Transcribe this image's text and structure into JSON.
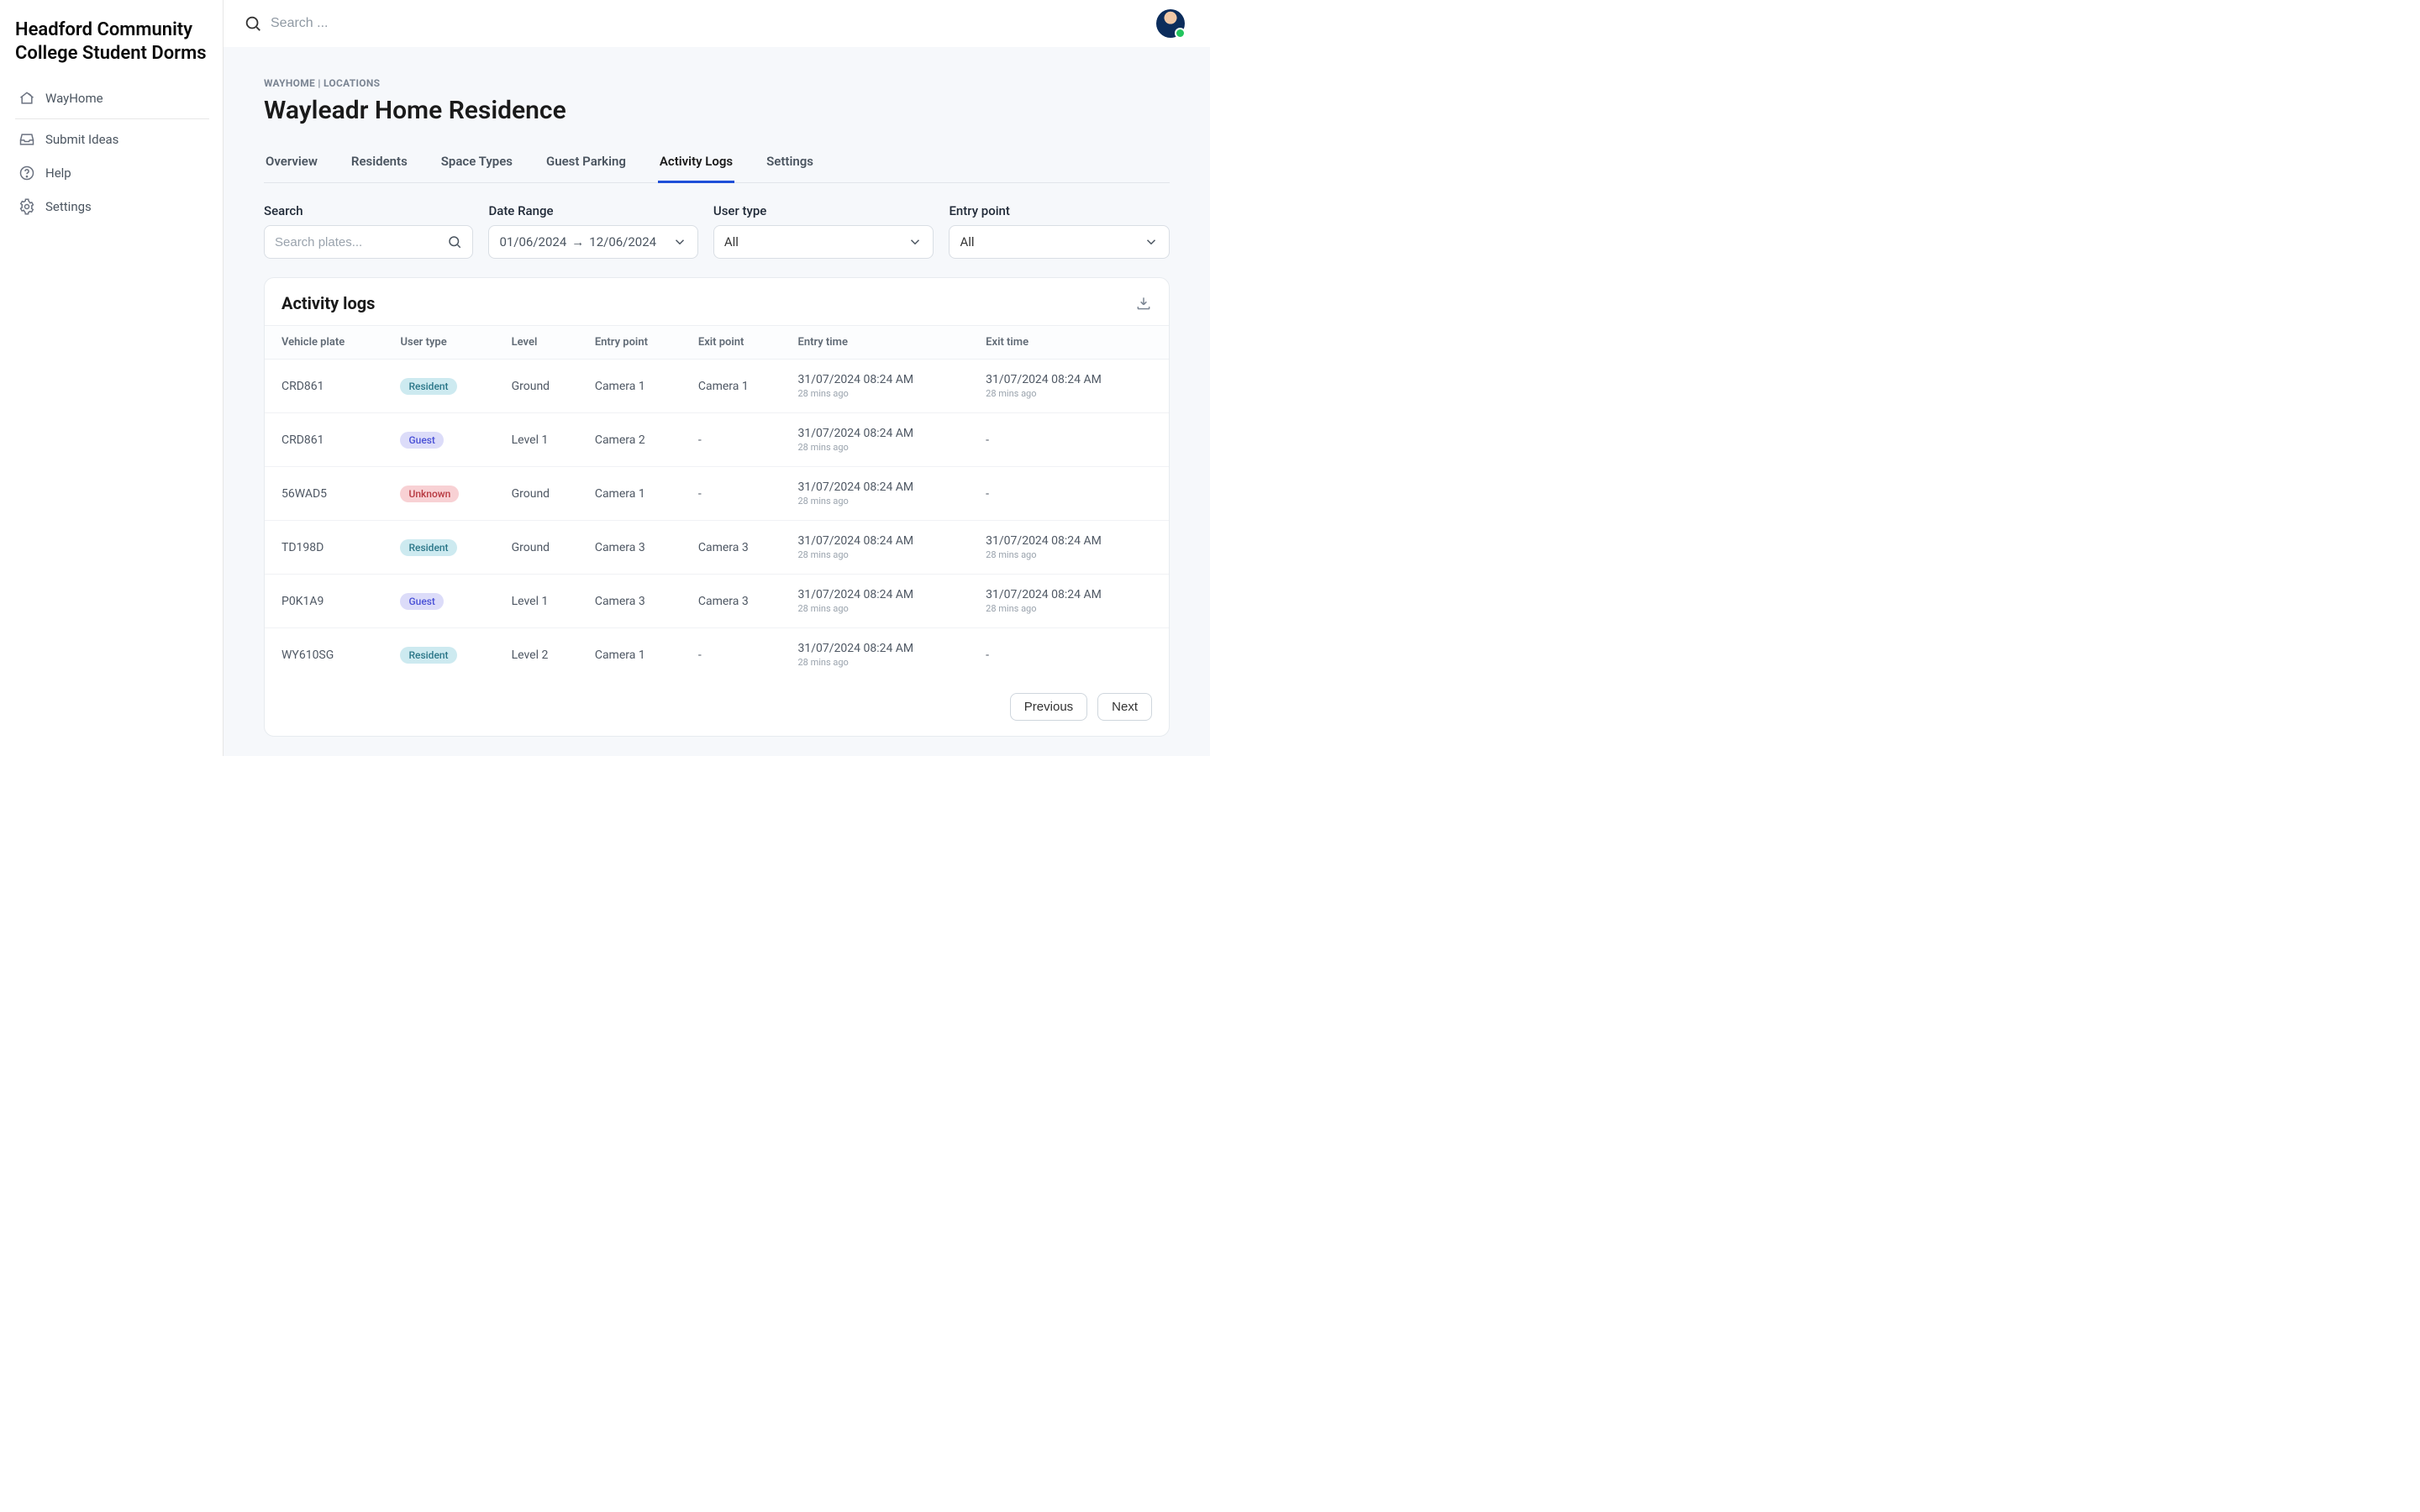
{
  "sidebar": {
    "title": "Headford Community College Student Dorms",
    "nav": [
      {
        "label": "WayHome",
        "icon": "home"
      },
      {
        "label": "Submit Ideas",
        "icon": "inbox"
      },
      {
        "label": "Help",
        "icon": "help"
      },
      {
        "label": "Settings",
        "icon": "gear"
      }
    ]
  },
  "topbar": {
    "search_placeholder": "Search ..."
  },
  "breadcrumb": "WAYHOME | LOCATIONS",
  "page_title": "Wayleadr Home Residence",
  "tabs": [
    {
      "label": "Overview",
      "active": false
    },
    {
      "label": "Residents",
      "active": false
    },
    {
      "label": "Space Types",
      "active": false
    },
    {
      "label": "Guest Parking",
      "active": false
    },
    {
      "label": "Activity Logs",
      "active": true
    },
    {
      "label": "Settings",
      "active": false
    }
  ],
  "filters": {
    "search_label": "Search",
    "search_placeholder": "Search plates...",
    "date_label": "Date Range",
    "date_from": "01/06/2024",
    "date_to": "12/06/2024",
    "user_type_label": "User type",
    "user_type_value": "All",
    "entry_point_label": "Entry point",
    "entry_point_value": "All"
  },
  "card": {
    "title": "Activity logs",
    "columns": [
      "Vehicle plate",
      "User type",
      "Level",
      "Entry point",
      "Exit point",
      "Entry time",
      "Exit time"
    ],
    "rows": [
      {
        "plate": "CRD861",
        "user_type": "Resident",
        "user_type_class": "resident",
        "level": "Ground",
        "entry_point": "Camera 1",
        "exit_point": "Camera 1",
        "entry_time": "31/07/2024 08:24 AM",
        "entry_ago": "28 mins ago",
        "exit_time": "31/07/2024 08:24 AM",
        "exit_ago": "28 mins ago"
      },
      {
        "plate": "CRD861",
        "user_type": "Guest",
        "user_type_class": "guest",
        "level": "Level 1",
        "entry_point": "Camera 2",
        "exit_point": "-",
        "entry_time": "31/07/2024 08:24 AM",
        "entry_ago": "28 mins ago",
        "exit_time": "-",
        "exit_ago": ""
      },
      {
        "plate": "56WAD5",
        "user_type": "Unknown",
        "user_type_class": "unknown",
        "level": "Ground",
        "entry_point": "Camera 1",
        "exit_point": "-",
        "entry_time": "31/07/2024 08:24 AM",
        "entry_ago": "28 mins ago",
        "exit_time": "-",
        "exit_ago": ""
      },
      {
        "plate": "TD198D",
        "user_type": "Resident",
        "user_type_class": "resident",
        "level": "Ground",
        "entry_point": "Camera 3",
        "exit_point": "Camera 3",
        "entry_time": "31/07/2024 08:24 AM",
        "entry_ago": "28 mins ago",
        "exit_time": "31/07/2024 08:24 AM",
        "exit_ago": "28 mins ago"
      },
      {
        "plate": "P0K1A9",
        "user_type": "Guest",
        "user_type_class": "guest",
        "level": "Level 1",
        "entry_point": "Camera 3",
        "exit_point": "Camera 3",
        "entry_time": "31/07/2024 08:24 AM",
        "entry_ago": "28 mins ago",
        "exit_time": "31/07/2024 08:24 AM",
        "exit_ago": "28 mins ago"
      },
      {
        "plate": "WY610SG",
        "user_type": "Resident",
        "user_type_class": "resident",
        "level": "Level 2",
        "entry_point": "Camera 1",
        "exit_point": "-",
        "entry_time": "31/07/2024 08:24 AM",
        "entry_ago": "28 mins ago",
        "exit_time": "-",
        "exit_ago": ""
      }
    ],
    "prev_label": "Previous",
    "next_label": "Next"
  }
}
